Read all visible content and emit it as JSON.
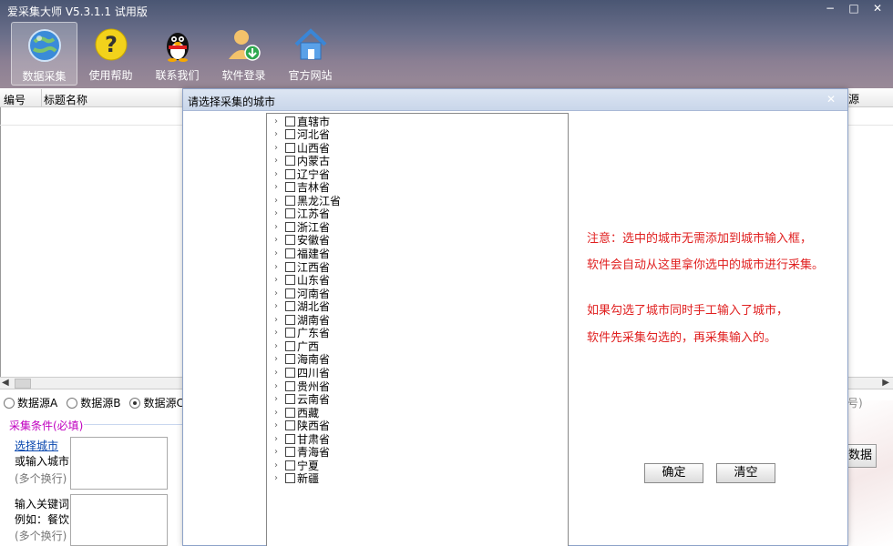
{
  "app": {
    "title": "爱采集大师 V5.3.1.1 试用版"
  },
  "window_controls": {
    "minimize": "−",
    "maximize": "□",
    "close": "✕"
  },
  "toolbar": [
    {
      "label": "数据采集",
      "icon": "globe-icon"
    },
    {
      "label": "使用帮助",
      "icon": "help-icon"
    },
    {
      "label": "联系我们",
      "icon": "penguin-icon"
    },
    {
      "label": "软件登录",
      "icon": "user-login-icon"
    },
    {
      "label": "官方网站",
      "icon": "home-icon"
    }
  ],
  "grid": {
    "col_id": "编号",
    "col_title": "标题名称",
    "col_right_fragment": "源"
  },
  "sources": {
    "a": "数据源A",
    "b": "数据源B",
    "c": "数据源C",
    "selected": "数据源C"
  },
  "conditions": {
    "label": "采集条件(必填)",
    "city_link": "选择城市",
    "city_label": "或输入城市",
    "city_hint": "(多个换行)",
    "kw_label": "输入关键词",
    "kw_example": "例如：餐饮",
    "kw_hint": "(多个换行)"
  },
  "right_fragments": {
    "note": "号)",
    "button": "数据"
  },
  "dialog": {
    "title": "请选择采集的城市",
    "close": "✕",
    "provinces": [
      "直辖市",
      "河北省",
      "山西省",
      "内蒙古",
      "辽宁省",
      "吉林省",
      "黑龙江省",
      "江苏省",
      "浙江省",
      "安徽省",
      "福建省",
      "江西省",
      "山东省",
      "河南省",
      "湖北省",
      "湖南省",
      "广东省",
      "广西",
      "海南省",
      "四川省",
      "贵州省",
      "云南省",
      "西藏",
      "陕西省",
      "甘肃省",
      "青海省",
      "宁夏",
      "新疆"
    ],
    "notes": [
      "注意：选中的城市无需添加到城市输入框，",
      "软件会自动从这里拿你选中的城市进行采集。",
      "如果勾选了城市同时手工输入了城市，",
      "软件先采集勾选的，再采集输入的。"
    ],
    "ok_button": "确定",
    "clear_button": "清空"
  }
}
